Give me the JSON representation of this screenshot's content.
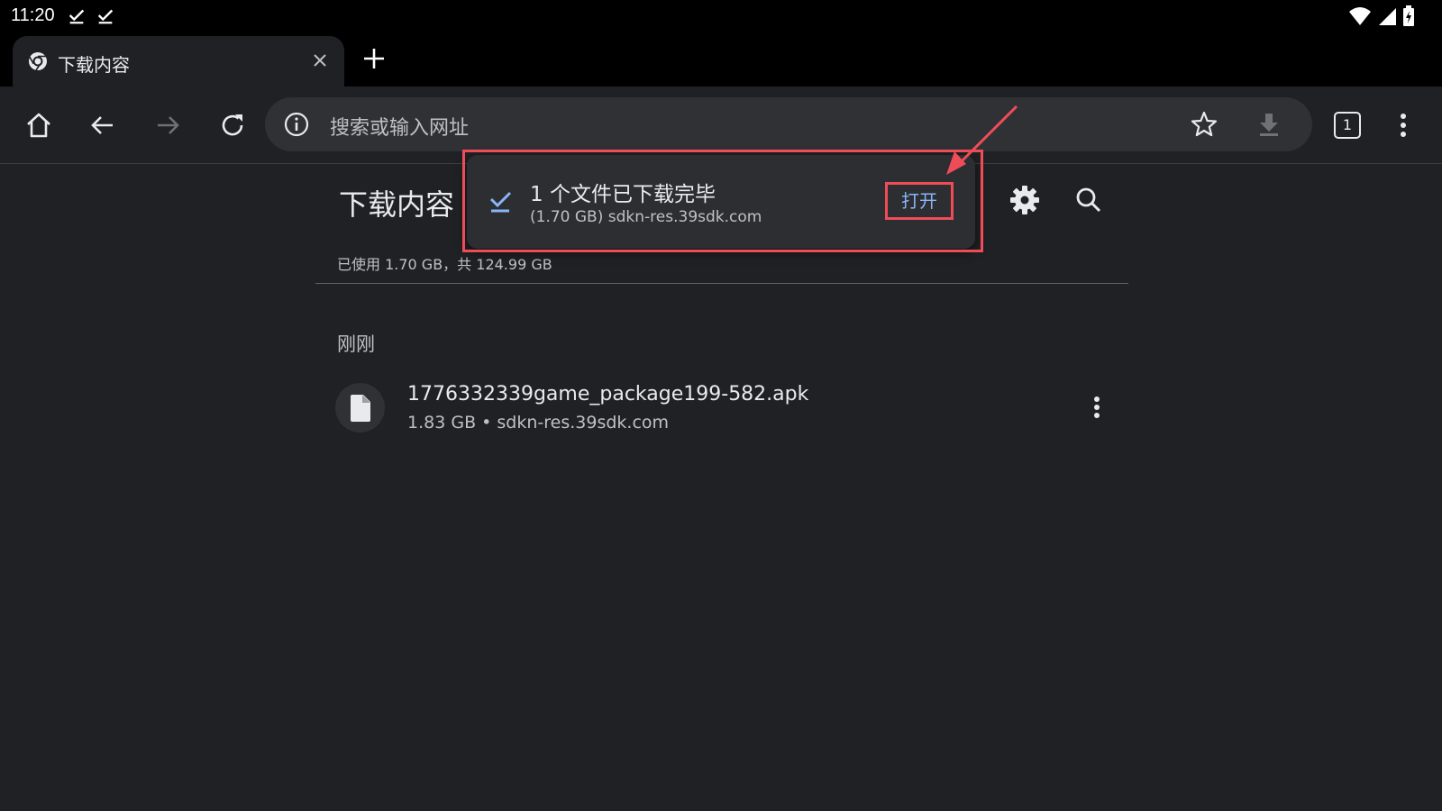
{
  "status_bar": {
    "time": "11:20"
  },
  "tab": {
    "title": "下载内容"
  },
  "omnibox": {
    "placeholder": "搜索或输入网址"
  },
  "toolbar": {
    "tab_count": "1"
  },
  "page": {
    "title": "下载内容",
    "storage": "已使用 1.70 GB，共 124.99 GB",
    "section": "刚刚"
  },
  "download": {
    "file_name": "1776332339game_package199-582.apk",
    "meta": "1.83 GB • sdkn-res.39sdk.com"
  },
  "popup": {
    "title": "1 个文件已下载完毕",
    "subtitle": "(1.70 GB) sdkn-res.39sdk.com",
    "open_label": "打开"
  },
  "colors": {
    "background": "#202124",
    "accent": "#8ab4f8",
    "annotation": "#ef4c5a"
  }
}
